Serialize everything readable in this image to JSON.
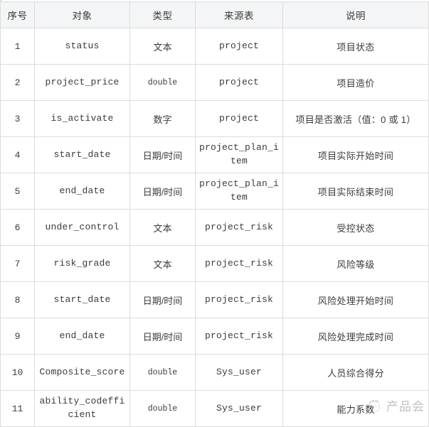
{
  "table": {
    "columns": [
      {
        "key": "seq",
        "label": "序号"
      },
      {
        "key": "obj",
        "label": "对象"
      },
      {
        "key": "type",
        "label": "类型"
      },
      {
        "key": "src",
        "label": "来源表"
      },
      {
        "key": "desc",
        "label": "说明"
      }
    ],
    "rows": [
      {
        "seq": "1",
        "obj": "status",
        "type": "文本",
        "src": "project",
        "desc": "项目状态"
      },
      {
        "seq": "2",
        "obj": "project_price",
        "type": "double",
        "src": "project",
        "desc": "项目造价"
      },
      {
        "seq": "3",
        "obj": "is_activate",
        "type": "数字",
        "src": "project",
        "desc": "项目是否激活（值：0 或 1）"
      },
      {
        "seq": "4",
        "obj": "start_date",
        "type": "日期/时间",
        "src": "project_plan_item",
        "desc": "项目实际开始时间"
      },
      {
        "seq": "5",
        "obj": "end_date",
        "type": "日期/时间",
        "src": "project_plan_item",
        "desc": "项目实际结束时间"
      },
      {
        "seq": "6",
        "obj": "under_control",
        "type": "文本",
        "src": "project_risk",
        "desc": "受控状态"
      },
      {
        "seq": "7",
        "obj": "risk_grade",
        "type": "文本",
        "src": "project_risk",
        "desc": "风险等级"
      },
      {
        "seq": "8",
        "obj": "start_date",
        "type": "日期/时间",
        "src": "project_risk",
        "desc": "风险处理开始时间"
      },
      {
        "seq": "9",
        "obj": "end_date",
        "type": "日期/时间",
        "src": "project_risk",
        "desc": "风险处理完成时间"
      },
      {
        "seq": "10",
        "obj": "Composite_score",
        "type": "double",
        "src": "Sys_user",
        "desc": "人员综合得分"
      },
      {
        "seq": "11",
        "obj": "ability_codefficient",
        "type": "double",
        "src": "Sys_user",
        "desc": "能力系数"
      }
    ]
  },
  "watermark": {
    "text": "产品会",
    "icon": "brand-circle-icon"
  },
  "colors": {
    "header_background": "#f4f5f6",
    "grid_line": "#dcdcdc",
    "text": "#3b3b3b",
    "watermark_text": "#8d8d8d",
    "page_background": "#ffffff"
  }
}
